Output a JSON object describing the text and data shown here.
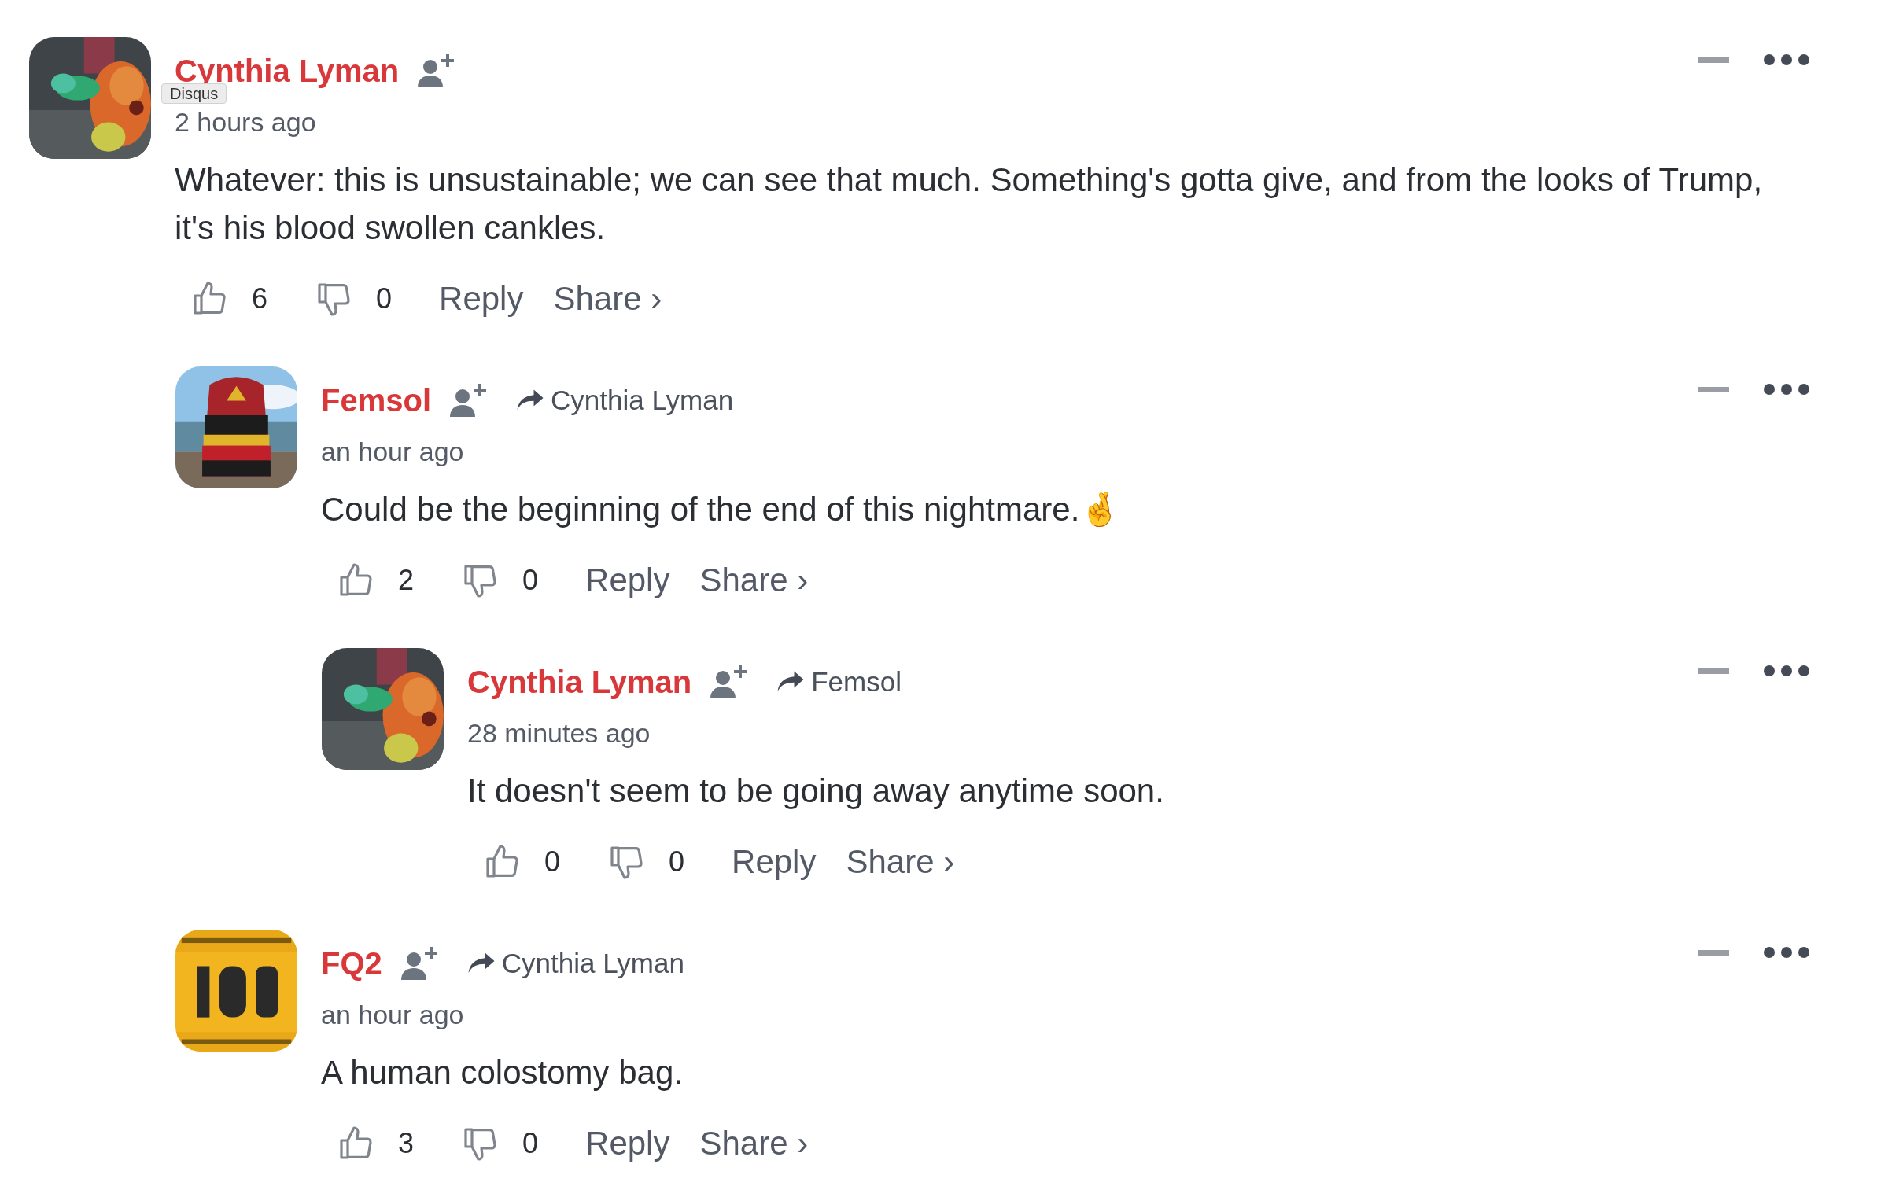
{
  "comments": [
    {
      "author": "Cynthia Lyman",
      "tooltip": "Disqus",
      "time": "2 hours ago",
      "text": "Whatever: this is unsustainable; we can see that much. Something's gotta give, and from the looks of Trump, it's his blood swollen cankles.",
      "likes": "6",
      "dislikes": "0",
      "reply_label": "Reply",
      "share_label": "Share ›",
      "children": [
        {
          "author": "Femsol",
          "reply_to": "Cynthia Lyman",
          "time": "an hour ago",
          "text": "Could be the beginning of the end of this nightmare.🤞",
          "likes": "2",
          "dislikes": "0",
          "reply_label": "Reply",
          "share_label": "Share ›",
          "children": [
            {
              "author": "Cynthia Lyman",
              "reply_to": "Femsol",
              "time": "28 minutes ago",
              "text": "It doesn't seem to be going away anytime soon.",
              "likes": "0",
              "dislikes": "0",
              "reply_label": "Reply",
              "share_label": "Share ›"
            }
          ]
        },
        {
          "author": "FQ2",
          "reply_to": "Cynthia Lyman",
          "time": "an hour ago",
          "text": "A human colostomy bag.",
          "likes": "3",
          "dislikes": "0",
          "reply_label": "Reply",
          "share_label": "Share ›"
        }
      ]
    }
  ]
}
